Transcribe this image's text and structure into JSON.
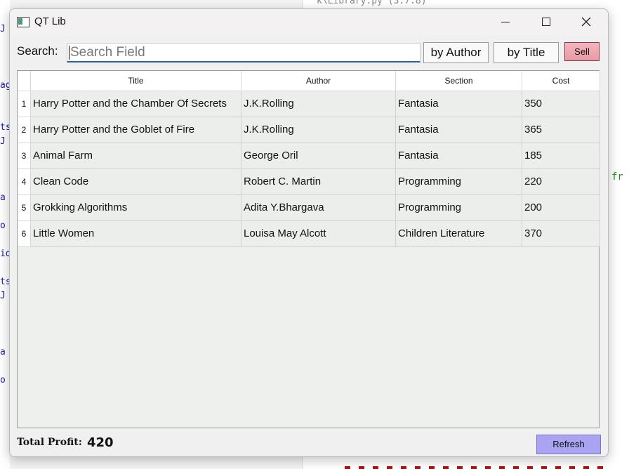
{
  "background": {
    "editor_tab_text": "k\\Library.py (3.7.8)",
    "side_glyphs": [
      "J",
      "ag",
      "ts",
      "J",
      "a",
      "o",
      "id",
      "ts",
      "J",
      "a",
      "o"
    ],
    "right_glyph": "fr"
  },
  "window": {
    "title": "QT Lib",
    "app_icon": "window-app-icon",
    "controls": {
      "minimize": "minimize-icon",
      "maximize": "maximize-icon",
      "close": "close-icon"
    }
  },
  "search": {
    "label": "Search:",
    "placeholder": "Search Field",
    "value": ""
  },
  "buttons": {
    "by_author": "by Author",
    "by_title": "by Title",
    "sell": "Sell",
    "refresh": "Refresh"
  },
  "colors": {
    "sell_button": "#e89ca6",
    "refresh_button": "#a9a3f2",
    "search_underline": "#2a5fa8"
  },
  "table": {
    "columns": [
      "Title",
      "Author",
      "Section",
      "Cost"
    ],
    "rows": [
      {
        "num": "1",
        "title": "Harry Potter and the Chamber Of Secrets",
        "author": "J.K.Rolling",
        "section": "Fantasia",
        "cost": "350"
      },
      {
        "num": "2",
        "title": "Harry Potter and the Goblet of Fire",
        "author": "J.K.Rolling",
        "section": "Fantasia",
        "cost": "365"
      },
      {
        "num": "3",
        "title": "Animal Farm",
        "author": "George Oril",
        "section": "Fantasia",
        "cost": "185"
      },
      {
        "num": "4",
        "title": "Clean Code",
        "author": "Robert C. Martin",
        "section": "Programming",
        "cost": "220"
      },
      {
        "num": "5",
        "title": "Grokking Algorithms",
        "author": "Adita Y.Bhargava",
        "section": "Programming",
        "cost": "200"
      },
      {
        "num": "6",
        "title": "Little Women",
        "author": "Louisa May Alcott",
        "section": "Children Literature",
        "cost": "370"
      }
    ]
  },
  "footer": {
    "profit_label": "Total Profit:",
    "profit_value": "420"
  }
}
